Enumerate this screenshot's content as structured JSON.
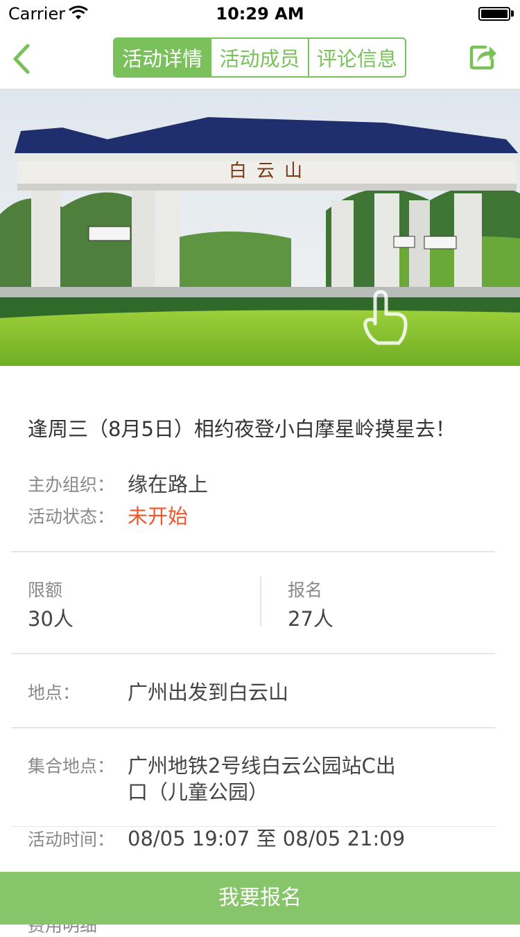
{
  "status_bar": {
    "carrier": "Carrier",
    "time": "10:29 AM"
  },
  "nav": {
    "tabs": [
      {
        "label": "活动详情",
        "active": true
      },
      {
        "label": "活动成员",
        "active": false
      },
      {
        "label": "评论信息",
        "active": false
      }
    ],
    "back_icon": "chevron-left-icon",
    "share_icon": "share-icon",
    "accent_color": "#7ac15c"
  },
  "activity": {
    "title": "逢周三（8月5日）相约夜登小白摩星岭摸星去！",
    "organizer_label": "主办组织：",
    "organizer": "缘在路上",
    "status_label": "活动状态：",
    "status": "未开始",
    "status_color": "#f0562a",
    "quota_label": "限额",
    "quota": "30人",
    "registered_label": "报名",
    "registered": "27人",
    "location_label": "地点：",
    "location": "广州出发到白云山",
    "meeting_label": "集合地点：",
    "meeting_line1": "广州地铁2号线白云公园站C出",
    "meeting_line2": "口（儿童公园）",
    "time_label": "活动时间：",
    "time": "08/05 19:07 至 08/05 21:09",
    "fee_label": "费用明细"
  },
  "footer": {
    "signup_label": "我要报名",
    "signup_color": "#86c56a"
  }
}
